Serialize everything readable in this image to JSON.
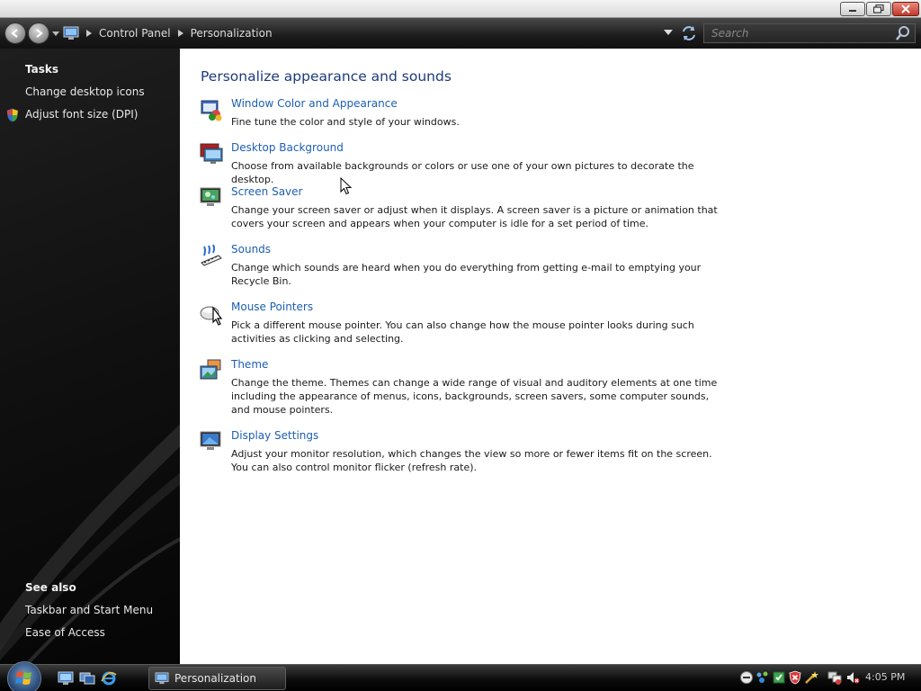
{
  "window": {
    "title": "Personalization"
  },
  "addressbar": {
    "breadcrumbs": [
      "Control Panel",
      "Personalization"
    ],
    "search_placeholder": "Search"
  },
  "sidebar": {
    "tasks_heading": "Tasks",
    "tasks": [
      {
        "label": "Change desktop icons"
      },
      {
        "label": "Adjust font size (DPI)",
        "icon": "shield-icon"
      }
    ],
    "see_also_heading": "See also",
    "see_also": [
      {
        "label": "Taskbar and Start Menu"
      },
      {
        "label": "Ease of Access"
      }
    ]
  },
  "main": {
    "title": "Personalize appearance and sounds",
    "items": [
      {
        "icon": "window-color-icon",
        "link": "Window Color and Appearance",
        "desc": "Fine tune the color and style of your windows."
      },
      {
        "icon": "desktop-background-icon",
        "link": "Desktop Background",
        "desc": "Choose from available backgrounds or colors or use one of your own pictures to decorate the desktop."
      },
      {
        "icon": "screen-saver-icon",
        "link": "Screen Saver",
        "desc": "Change your screen saver or adjust when it displays. A screen saver is a picture or animation that covers your screen and appears when your computer is idle for a set period of time."
      },
      {
        "icon": "sounds-icon",
        "link": "Sounds",
        "desc": "Change which sounds are heard when you do everything from getting e-mail to emptying your Recycle Bin."
      },
      {
        "icon": "mouse-pointers-icon",
        "link": "Mouse Pointers",
        "desc": "Pick a different mouse pointer. You can also change how the mouse pointer looks during such activities as clicking and selecting."
      },
      {
        "icon": "theme-icon",
        "link": "Theme",
        "desc": "Change the theme. Themes can change a wide range of visual and auditory elements at one time including the appearance of menus, icons, backgrounds, screen savers, some computer sounds, and mouse pointers."
      },
      {
        "icon": "display-settings-icon",
        "link": "Display Settings",
        "desc": "Adjust your monitor resolution, which changes the view so more or fewer items fit on the screen. You can also control monitor flicker (refresh rate)."
      }
    ]
  },
  "taskbar": {
    "task_label": "Personalization",
    "clock": "4:05 PM"
  },
  "colors": {
    "link": "#1d5fb3",
    "title": "#1e3b7a",
    "pane_bg": "#101010"
  }
}
